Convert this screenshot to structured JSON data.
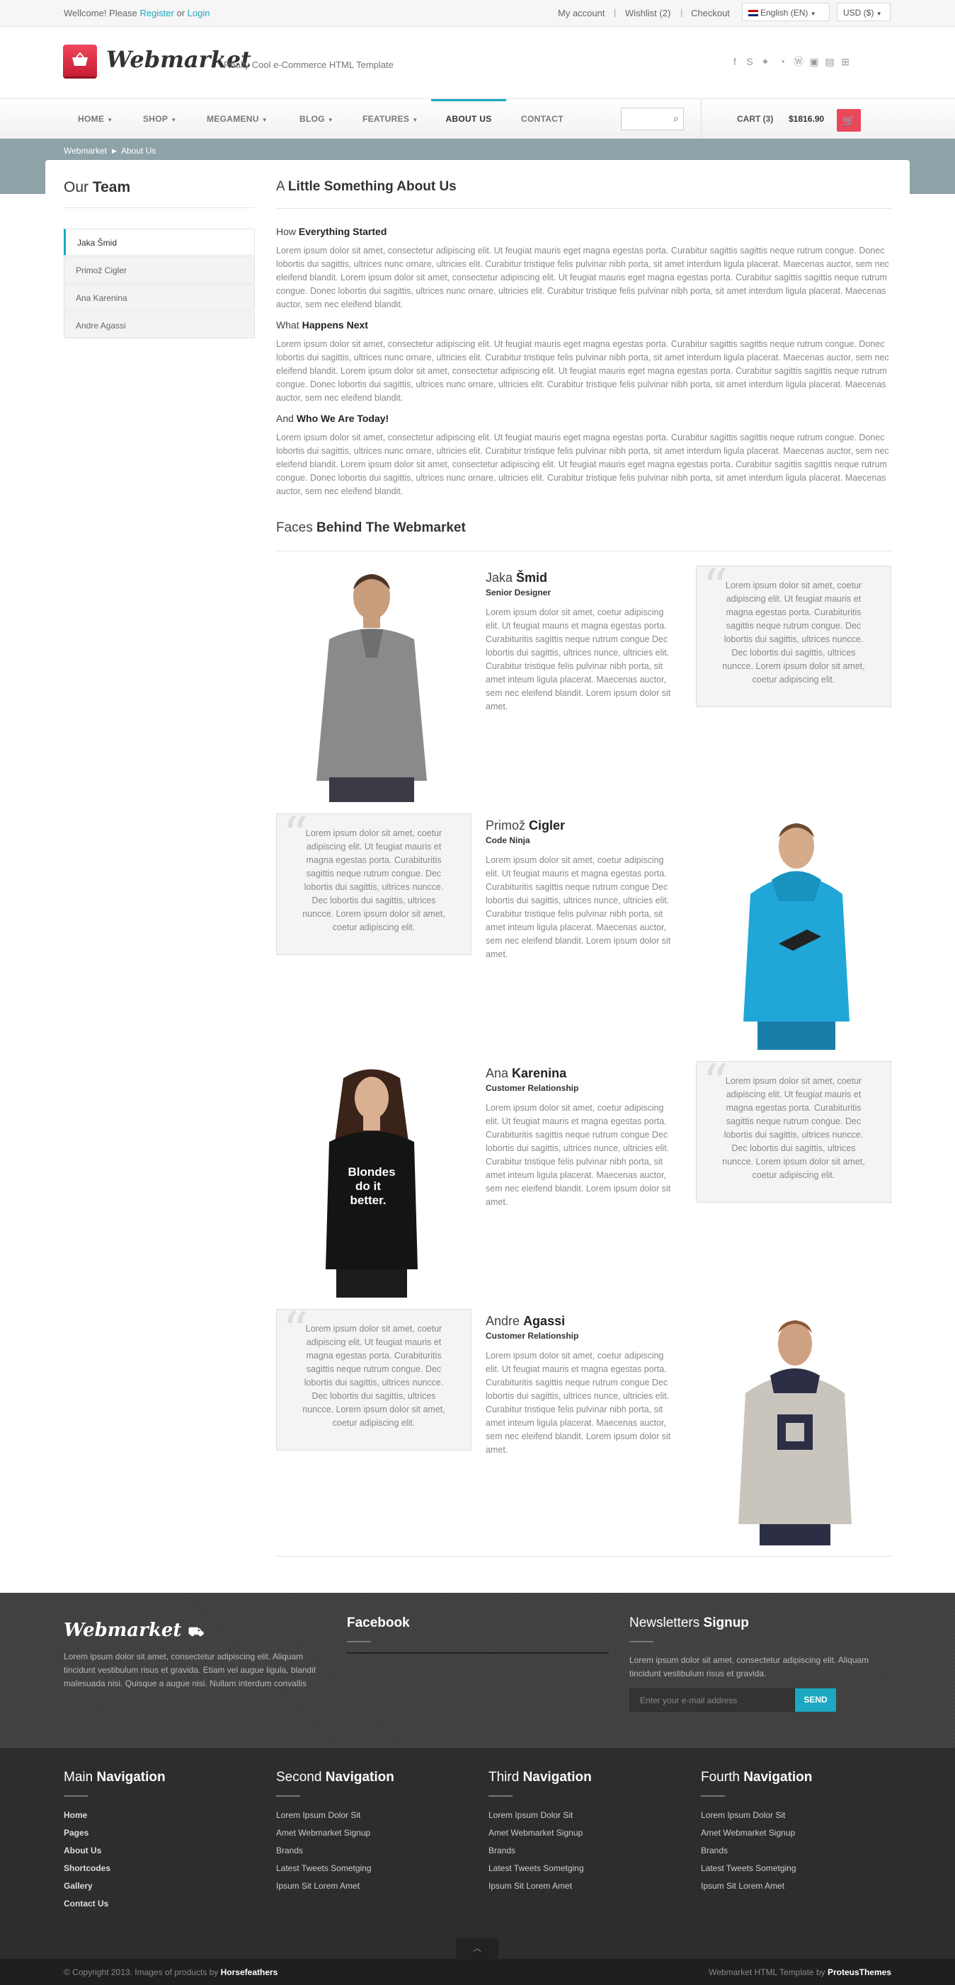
{
  "topbar": {
    "welcome": "Wellcome! Please",
    "register": "Register",
    "or": "or",
    "login": "Login",
    "my_account": "My account",
    "wishlist": "Wishlist (2)",
    "checkout": "Checkout",
    "language": "English (EN)",
    "currency": "USD ($)"
  },
  "header": {
    "logo": "Webmarket",
    "tagline": "Really Cool e-Commerce HTML Template",
    "social_icons": [
      "facebook-icon",
      "skype-icon",
      "twitter-icon",
      "rss-icon",
      "wordpress-icon",
      "android-icon",
      "html5-icon",
      "windows-icon"
    ]
  },
  "nav": {
    "items": [
      "HOME",
      "SHOP",
      "MEGAMENU",
      "BLOG",
      "FEATURES",
      "ABOUT US",
      "CONTACT"
    ],
    "active": "ABOUT US",
    "cart_label": "CART",
    "cart_count": "(3)",
    "cart_total": "$1816.90"
  },
  "breadcrumb": {
    "home": "Webmarket",
    "current": "About Us"
  },
  "sidebar": {
    "title_light": "Our",
    "title_bold": "Team",
    "items": [
      "Jaka Šmid",
      "Primož Cigler",
      "Ana Karenina",
      "Andre Agassi"
    ]
  },
  "about": {
    "title_light": "A",
    "title_bold": "Little Something About Us",
    "sections": [
      {
        "light": "How",
        "bold": "Everything Started",
        "text": "Lorem ipsum dolor sit amet, consectetur adipiscing elit. Ut feugiat mauris eget magna egestas porta. Curabitur sagittis sagittis neque rutrum congue. Donec lobortis dui sagittis, ultrices nunc ornare, ultricies elit. Curabitur tristique felis pulvinar nibh porta, sit amet interdum ligula placerat. Maecenas auctor, sem nec eleifend blandit. Lorem ipsum dolor sit amet, consectetur adipiscing elit. Ut feugiat mauris eget magna egestas porta. Curabitur sagittis sagittis neque rutrum congue. Donec lobortis dui sagittis, ultrices nunc ornare, ultricies elit. Curabitur tristique felis pulvinar nibh porta, sit amet interdum ligula placerat. Maecenas auctor, sem nec eleifend blandit."
      },
      {
        "light": "What",
        "bold": "Happens Next",
        "text": "Lorem ipsum dolor sit amet, consectetur adipiscing elit. Ut feugiat mauris eget magna egestas porta. Curabitur sagittis sagittis neque rutrum congue. Donec lobortis dui sagittis, ultrices nunc ornare, ultricies elit. Curabitur tristique felis pulvinar nibh porta, sit amet interdum ligula placerat. Maecenas auctor, sem nec eleifend blandit. Lorem ipsum dolor sit amet, consectetur adipiscing elit. Ut feugiat mauris eget magna egestas porta. Curabitur sagittis sagittis neque rutrum congue. Donec lobortis dui sagittis, ultrices nunc ornare, ultricies elit. Curabitur tristique felis pulvinar nibh porta, sit amet interdum ligula placerat. Maecenas auctor, sem nec eleifend blandit."
      },
      {
        "light": "And",
        "bold": "Who We Are Today!",
        "text": "Lorem ipsum dolor sit amet, consectetur adipiscing elit. Ut feugiat mauris eget magna egestas porta. Curabitur sagittis sagittis neque rutrum congue. Donec lobortis dui sagittis, ultrices nunc ornare, ultricies elit. Curabitur tristique felis pulvinar nibh porta, sit amet interdum ligula placerat. Maecenas auctor, sem nec eleifend blandit. Lorem ipsum dolor sit amet, consectetur adipiscing elit. Ut feugiat mauris eget magna egestas porta. Curabitur sagittis sagittis neque rutrum congue. Donec lobortis dui sagittis, ultrices nunc ornare, ultricies elit. Curabitur tristique felis pulvinar nibh porta, sit amet interdum ligula placerat. Maecenas auctor, sem nec eleifend blandit."
      }
    ]
  },
  "faces": {
    "title_light": "Faces",
    "title_bold": "Behind The Webmarket",
    "members": [
      {
        "first": "Jaka",
        "last": "Šmid",
        "role": "Senior Designer"
      },
      {
        "first": "Primož",
        "last": "Cigler",
        "role": "Code Ninja"
      },
      {
        "first": "Ana",
        "last": "Karenina",
        "role": "Customer Relationship"
      },
      {
        "first": "Andre",
        "last": "Agassi",
        "role": "Customer Relationship"
      }
    ],
    "bio": "Lorem ipsum dolor sit amet, coetur adipiscing elit. Ut feugiat mauris et magna egestas porta. Curabituritis sagittis neque rutrum congue Dec lobortis dui sagittis, ultrices nunce, ultricies elit. Curabitur tristique felis pulvinar nibh porta, sit amet inteum ligula placerat. Maecenas auctor, sem nec eleifend blandit. Lorem ipsum dolor sit amet.",
    "quote": "Lorem ipsum dolor sit amet, coetur adipiscing elit. Ut feugiat mauris et magna egestas porta. Curabituritis sagittis neque rutrum congue. Dec lobortis dui sagittis, ultrices nuncce. Dec lobortis dui sagittis, ultrices nuncce. Lorem ipsum dolor sit amet, coetur adipiscing elit.",
    "shirt_text": "Blondes do it better."
  },
  "footer": {
    "logo": "Webmarket",
    "about_text": "Lorem ipsum dolor sit amet, consectetur adipiscing elit. Aliquam tincidunt vestibulum risus et gravida. Etiam vel augue ligula, blandit malesuada nisi. Quisque a augue nisi. Nullam interdum convallis",
    "facebook_title": "Facebook",
    "newsletter_light": "Newsletters",
    "newsletter_bold": "Signup",
    "newsletter_text": "Lorem ipsum dolor sit amet, consectetur adipiscing elit. Aliquam tincidunt vestibulum risus et gravida.",
    "email_placeholder": "Enter your e-mail address",
    "send": "SEND",
    "nav_columns": [
      {
        "light": "Main",
        "bold": "Navigation",
        "links": [
          "Home",
          "Pages",
          "About Us",
          "Shortcodes",
          "Gallery",
          "Contact Us"
        ]
      },
      {
        "light": "Second",
        "bold": "Navigation",
        "links": [
          "Lorem Ipsum Dolor Sit",
          "Amet Webmarket Signup",
          "Brands",
          "Latest Tweets Sometging",
          "Ipsum Sit Lorem Amet"
        ]
      },
      {
        "light": "Third",
        "bold": "Navigation",
        "links": [
          "Lorem Ipsum Dolor Sit",
          "Amet Webmarket Signup",
          "Brands",
          "Latest Tweets Sometging",
          "Ipsum Sit Lorem Amet"
        ]
      },
      {
        "light": "Fourth",
        "bold": "Navigation",
        "links": [
          "Lorem Ipsum Dolor Sit",
          "Amet Webmarket Signup",
          "Brands",
          "Latest Tweets Sometging",
          "Ipsum Sit Lorem Amet"
        ]
      }
    ],
    "copyright": "© Copyright 2013. Images of products by",
    "copyright_brand": "Horsefeathers",
    "template_by": "Webmarket HTML Template by",
    "template_author": "ProteusThemes"
  }
}
